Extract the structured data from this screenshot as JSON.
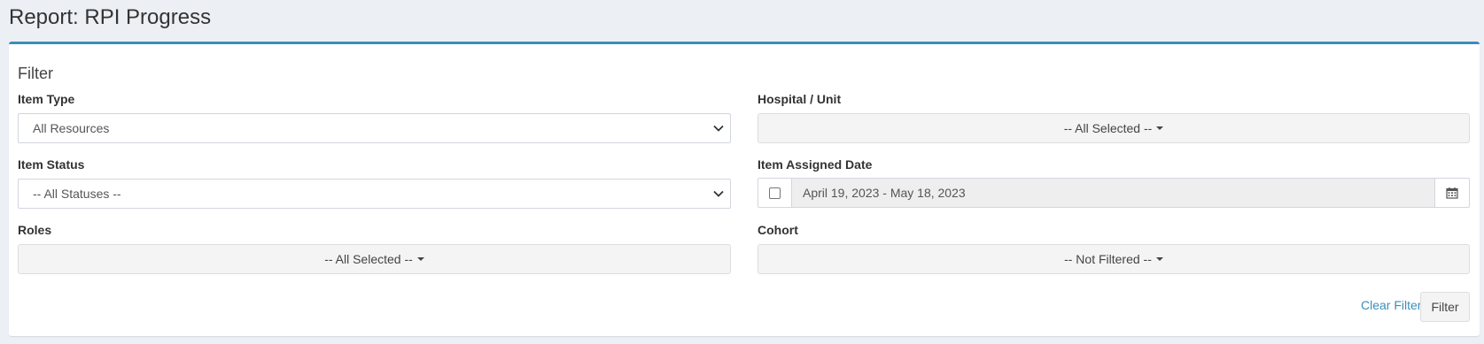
{
  "header": {
    "title": "Report: RPI Progress"
  },
  "filter": {
    "title": "Filter",
    "item_type": {
      "label": "Item Type",
      "value": "All Resources"
    },
    "hospital_unit": {
      "label": "Hospital / Unit",
      "value": "-- All Selected --"
    },
    "item_status": {
      "label": "Item Status",
      "value": "-- All Statuses --"
    },
    "item_assigned_date": {
      "label": "Item Assigned Date",
      "value": "April 19, 2023 - May 18, 2023",
      "checked": false
    },
    "roles": {
      "label": "Roles",
      "value": "-- All Selected --"
    },
    "cohort": {
      "label": "Cohort",
      "value": "-- Not Filtered --"
    },
    "clear_label": "Clear Filter",
    "filter_label": "Filter"
  },
  "icons": {
    "select_chevron": "chevron-down-icon",
    "dropdown_caret": "caret-down-icon",
    "calendar": "calendar-icon"
  },
  "colors": {
    "accent": "#3c8dbc",
    "background": "#ecf0f5",
    "button": "#f4f4f4"
  }
}
